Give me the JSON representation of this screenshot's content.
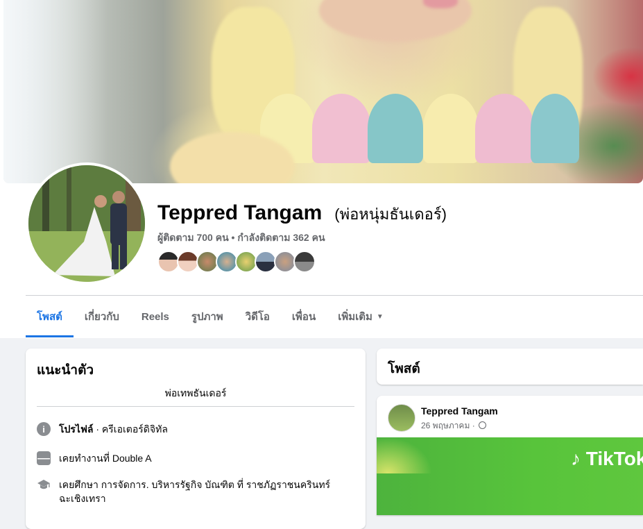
{
  "profile": {
    "name": "Teppred Tangam",
    "alt_name": "(พ่อหนุ่มธันเดอร์)",
    "followers_text": "ผู้ติดตาม 700 คน • กำลังติดตาม 362 คน"
  },
  "tabs": [
    {
      "label": "โพสต์",
      "active": true
    },
    {
      "label": "เกี่ยวกับ"
    },
    {
      "label": "Reels"
    },
    {
      "label": "รูปภาพ"
    },
    {
      "label": "วิดีโอ"
    },
    {
      "label": "เพื่อน"
    },
    {
      "label": "เพิ่มเติม"
    }
  ],
  "intro": {
    "title": "แนะนำตัว",
    "bio": "พ่อเทพธันเดอร์",
    "profile_label": "โปรไฟล์",
    "profile_value": " · ครีเอเตอร์ดิจิทัล",
    "work": "เคยทำงานที่ Double A",
    "education": "เคยศึกษา การจัดการ. บริหารรัฐกิจ บัณฑิต ที่ ราชภัฏราชนครินทร์ ฉะเชิงเทรา"
  },
  "posts": {
    "title": "โพสต์",
    "item": {
      "author": "Teppred Tangam",
      "date": "26 พฤษภาคม ·",
      "media_text": "TikTok"
    }
  },
  "colors": {
    "accent": "#1b74e4",
    "secondary_text": "#65676b",
    "media_green": "#58c43b"
  }
}
